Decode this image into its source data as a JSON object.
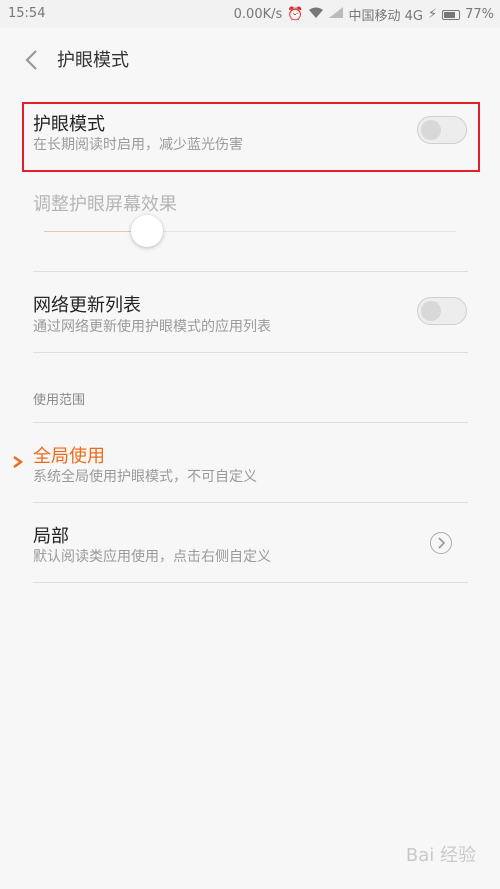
{
  "status_bar": {
    "time": "15:54",
    "net_speed": "0.00K/s",
    "carrier": "中国移动 4G",
    "battery": "77%"
  },
  "header": {
    "title": "护眼模式"
  },
  "eye_mode": {
    "title": "护眼模式",
    "subtitle": "在长期阅读时启用，减少蓝光伤害",
    "enabled": false
  },
  "effect": {
    "title": "调整护眼屏幕效果",
    "level": 0.25
  },
  "network_list": {
    "title": "网络更新列表",
    "subtitle": "通过网络更新使用护眼模式的应用列表",
    "enabled": false
  },
  "scope": {
    "section_title": "使用范围",
    "global": {
      "title": "全局使用",
      "subtitle": "系统全局使用护眼模式，不可自定义",
      "selected": true
    },
    "partial": {
      "title": "局部",
      "subtitle": "默认阅读类应用使用，点击右侧自定义",
      "selected": false
    }
  },
  "colors": {
    "accent": "#f06a1a",
    "highlight": "#e0212b"
  },
  "watermark": "Bai 经验"
}
